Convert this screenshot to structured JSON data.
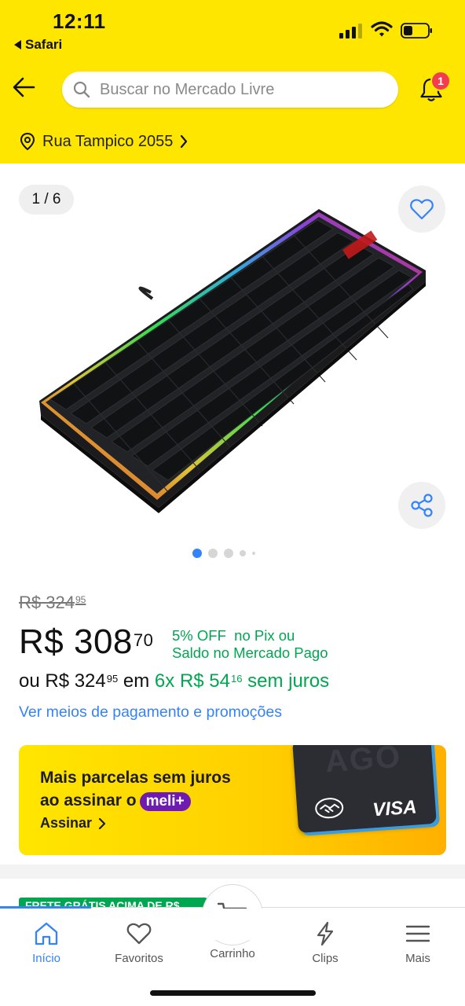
{
  "status_bar": {
    "time": "12:11",
    "back_app": "Safari"
  },
  "header": {
    "search_placeholder": "Buscar no Mercado Livre",
    "notifications_count": "1",
    "address": "Rua Tampico 2055"
  },
  "gallery": {
    "counter": "1 / 6",
    "total_images": 6,
    "current_index": 1
  },
  "pricing": {
    "old_price_main": "R$ 324",
    "old_price_cents": "95",
    "price_main": "R$ 308",
    "price_cents": "70",
    "discount_line1": "5% OFF  no Pix ou",
    "discount_line2": "Saldo no Mercado Pago",
    "installment_prefix": "ou R$ 324",
    "installment_prefix_cents": "95",
    "installment_mid": " em ",
    "installment_plan": "6x R$ 54",
    "installment_plan_cents": "16",
    "installment_suffix": " sem juros",
    "payment_link": "Ver meios de pagamento e promoções"
  },
  "promo": {
    "line1": "Mais parcelas sem juros",
    "line2": "ao assinar o",
    "brand_pill": "meli+",
    "cta": "Assinar",
    "card_bg_text": "AGO",
    "card_brand": "VISA"
  },
  "shipping_badge": "FRETE GRÁTIS ACIMA DE R$",
  "tabbar": {
    "items": [
      {
        "label": "Início",
        "icon": "home-icon",
        "active": true
      },
      {
        "label": "Favoritos",
        "icon": "heart-icon",
        "active": false
      },
      {
        "label": "Carrinho",
        "icon": "cart-icon",
        "active": false
      },
      {
        "label": "Clips",
        "icon": "clips-icon",
        "active": false
      },
      {
        "label": "Mais",
        "icon": "menu-icon",
        "active": false
      }
    ]
  },
  "colors": {
    "brand_yellow": "#ffe600",
    "accent_blue": "#3483fa",
    "price_green": "#00a650",
    "badge_red": "#f23d4f",
    "meli_purple": "#6f1ab1"
  }
}
